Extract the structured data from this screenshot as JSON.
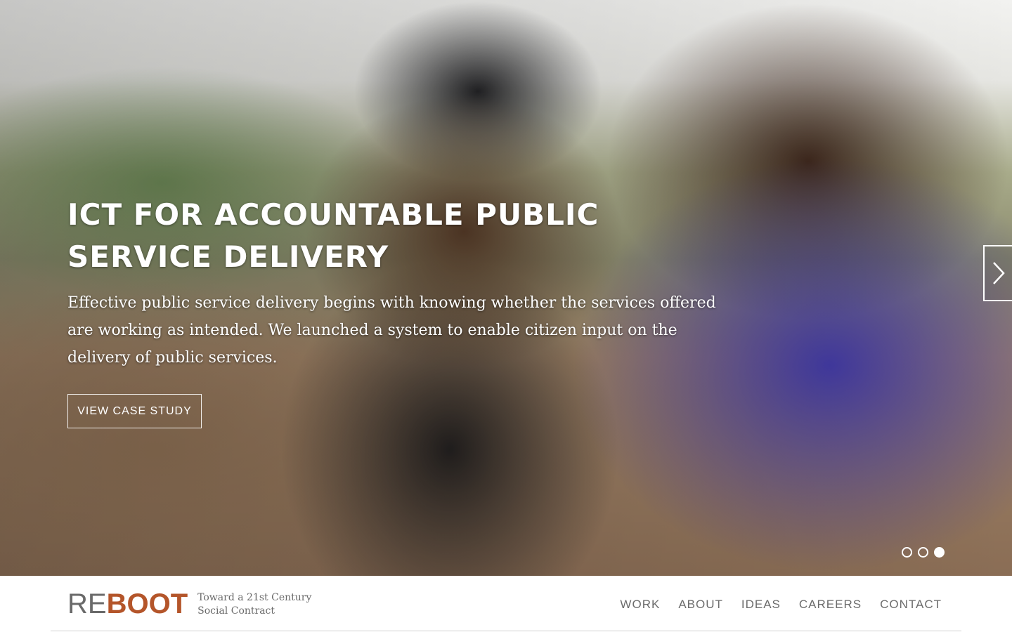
{
  "hero": {
    "title": "ICT FOR ACCOUNTABLE PUBLIC SERVICE DELIVERY",
    "description": "Effective public service delivery begins with knowing whether the services offered are working as intended. We launched a system to enable citizen input on the delivery of public services.",
    "cta_label": "VIEW CASE STUDY",
    "slides": {
      "total": 3,
      "active": 3
    }
  },
  "header": {
    "logo": {
      "part1": "RE",
      "part2": "BOOT",
      "color_primary": "#b4552a",
      "color_secondary": "#6a6a6a"
    },
    "tagline_line1": "Toward a 21st Century",
    "tagline_line2": "Social Contract",
    "nav": [
      "WORK",
      "ABOUT",
      "IDEAS",
      "CAREERS",
      "CONTACT"
    ]
  },
  "icons": {
    "next": "chevron-right-icon"
  }
}
